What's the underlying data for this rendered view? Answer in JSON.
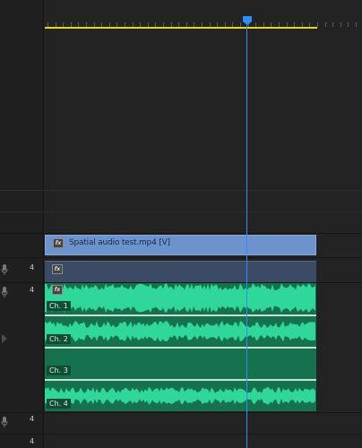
{
  "timeline": {
    "video_clip": {
      "name": "Spatial audio test.mp4 [V]",
      "fx_icon": "fx-icon"
    },
    "audio_channels": [
      {
        "label": "Ch. 1"
      },
      {
        "label": "Ch. 2"
      },
      {
        "label": "Ch. 3"
      },
      {
        "label": "Ch. 4"
      }
    ],
    "track_numbers": {
      "stereo_track": "4",
      "spatial_track": "4",
      "lower_track_1": "4",
      "lower_track_2": "4"
    },
    "colors": {
      "video_clip": "#6c93cd",
      "audio_clip": "#16714f",
      "waveform": "#2fd79a",
      "playhead": "#2e8dff",
      "work_area": "#e6d81e"
    }
  }
}
